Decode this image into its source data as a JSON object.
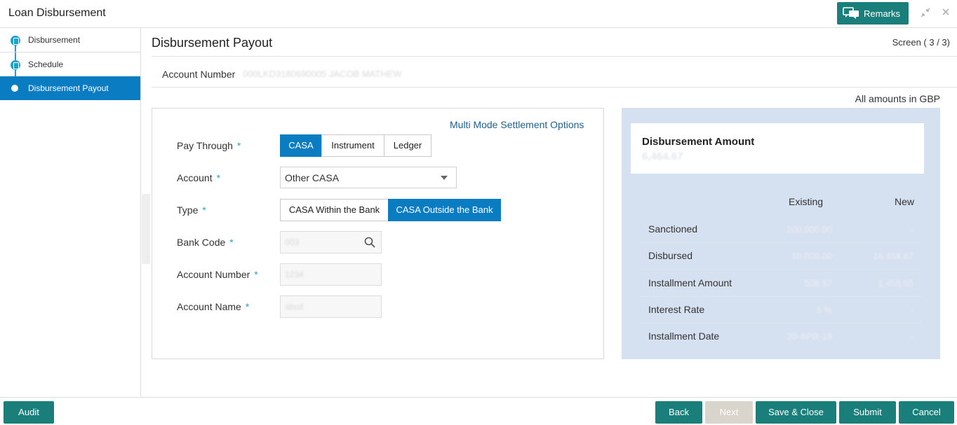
{
  "window": {
    "title": "Loan Disbursement",
    "remarks_label": "Remarks"
  },
  "steps": [
    {
      "label": "Disbursement"
    },
    {
      "label": "Schedule"
    },
    {
      "label": "Disbursement Payout"
    }
  ],
  "page": {
    "title": "Disbursement Payout",
    "screen_counter": "Screen ( 3 / 3)",
    "account_number_label": "Account Number",
    "account_number_value": "000LKD3180690005 JACOB MATHEW",
    "amounts_note": "All amounts in GBP"
  },
  "form": {
    "multi_mode_link": "Multi Mode Settlement Options",
    "pay_through": {
      "label": "Pay Through",
      "options": [
        "CASA",
        "Instrument",
        "Ledger"
      ],
      "selected": "CASA"
    },
    "account": {
      "label": "Account",
      "value": "Other CASA"
    },
    "type": {
      "label": "Type",
      "options": [
        "CASA Within the Bank",
        "CASA Outside the Bank"
      ],
      "selected": "CASA Outside the Bank"
    },
    "bank_code": {
      "label": "Bank Code",
      "value": "003"
    },
    "account_number": {
      "label": "Account Number",
      "value": "1234"
    },
    "account_name": {
      "label": "Account Name",
      "value": "abcd"
    },
    "required_mark": "*"
  },
  "summary": {
    "title": "Disbursement Amount",
    "amount": "6,464.67",
    "col_existing": "Existing",
    "col_new": "New",
    "rows": [
      {
        "label": "Sanctioned",
        "existing": "100,000.00",
        "new": "-"
      },
      {
        "label": "Disbursed",
        "existing": "10,000.00",
        "new": "16,464.67"
      },
      {
        "label": "Installment Amount",
        "existing": "508.57",
        "new": "1,455.55"
      },
      {
        "label": "Interest Rate",
        "existing": "5 %",
        "new": "-"
      },
      {
        "label": "Installment Date",
        "existing": "20-APR-18",
        "new": "-"
      }
    ]
  },
  "footer": {
    "audit": "Audit",
    "back": "Back",
    "next": "Next",
    "save_close": "Save & Close",
    "submit": "Submit",
    "cancel": "Cancel"
  },
  "colors": {
    "primary_teal": "#1a7f7a",
    "active_blue": "#0a7cc2",
    "step_dot": "#1aa3c8",
    "summary_bg": "#d5e0f0",
    "link": "#1f5f8b"
  }
}
